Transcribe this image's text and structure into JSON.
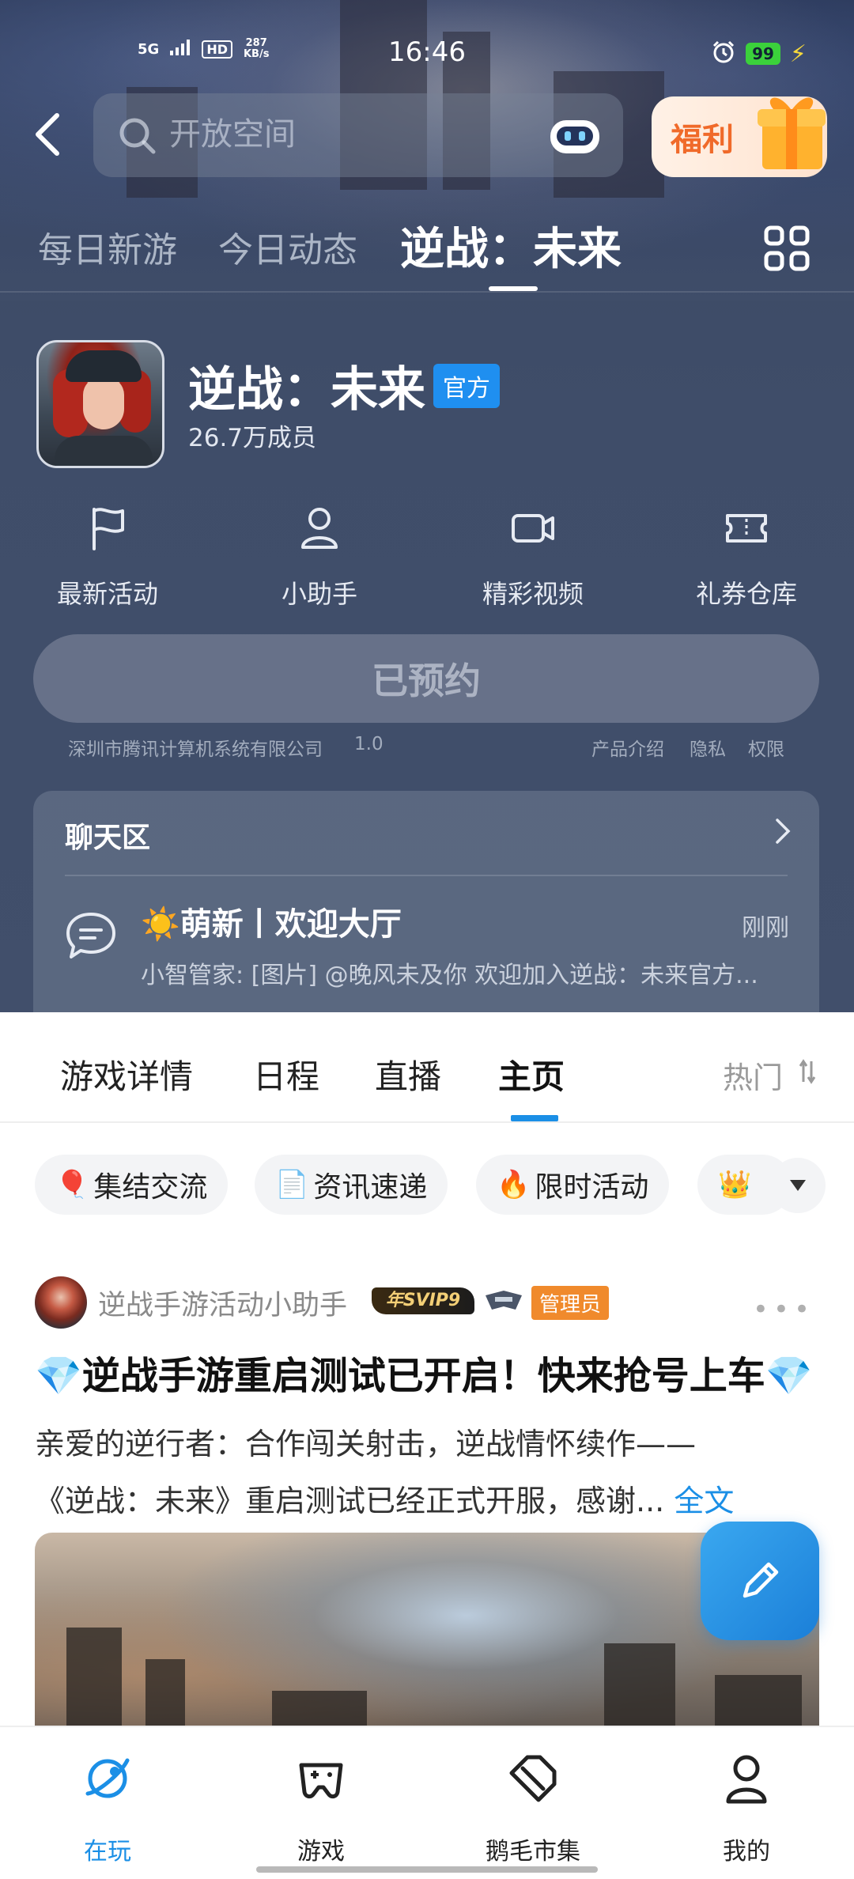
{
  "status_bar": {
    "network": "5G",
    "hd": "HD",
    "speed_value": "287",
    "speed_unit": "KB/s",
    "time": "16:46",
    "battery": "99"
  },
  "header": {
    "search_placeholder": "开放空间",
    "gift_label": "福利"
  },
  "top_tabs": [
    {
      "label": "每日新游"
    },
    {
      "label": "今日动态"
    },
    {
      "label": "逆战：未来",
      "active": true
    }
  ],
  "game": {
    "title": "逆战：未来",
    "badge": "官方",
    "members": "26.7万成员"
  },
  "shortcuts": [
    {
      "label": "最新活动",
      "icon": "flag-icon"
    },
    {
      "label": "小助手",
      "icon": "user-icon"
    },
    {
      "label": "精彩视频",
      "icon": "video-icon"
    },
    {
      "label": "礼券仓库",
      "icon": "ticket-icon"
    }
  ],
  "reserve_label": "已预约",
  "legal": {
    "company": "深圳市腾讯计算机系统有限公司",
    "version": "1.0",
    "intro": "产品介绍",
    "privacy": "隐私",
    "permission": "权限"
  },
  "chat": {
    "title": "聊天区",
    "room": "☀️萌新丨欢迎大厅",
    "time": "刚刚",
    "message": "小智管家: [图片] @晚风未及你 欢迎加入逆战：未来官方..."
  },
  "section_tabs": [
    {
      "label": "游戏详情"
    },
    {
      "label": "日程"
    },
    {
      "label": "直播"
    },
    {
      "label": "主页",
      "active": true
    },
    {
      "label": "热门"
    }
  ],
  "chips": [
    {
      "emoji": "🎈",
      "label": "集结交流"
    },
    {
      "emoji": "📄",
      "label": "资讯速递"
    },
    {
      "emoji": "🔥",
      "label": "限时活动"
    },
    {
      "emoji": "👑",
      "label": "🙃"
    }
  ],
  "post": {
    "author": "逆战手游活动小助手",
    "svip": "年SVIP9",
    "admin": "管理员",
    "title": "💎逆战手游重启测试已开启！快来抢号上车💎",
    "body_line1": "亲爱的逆行者：合作闯关射击，逆战情怀续作——",
    "body_line2": "《逆战：未来》重启测试已经正式开服，感谢...",
    "more_label": "全文"
  },
  "bottom_nav": [
    {
      "label": "在玩",
      "active": true,
      "icon": "planet-icon"
    },
    {
      "label": "游戏",
      "icon": "gamepad-icon"
    },
    {
      "label": "鹅毛市集",
      "icon": "tag-icon"
    },
    {
      "label": "我的",
      "icon": "profile-icon"
    }
  ],
  "colors": {
    "accent": "#1b8fe6",
    "admin_badge": "#f08a2c",
    "gift_text": "#f06a2a",
    "official_badge": "#1f8ff0"
  }
}
